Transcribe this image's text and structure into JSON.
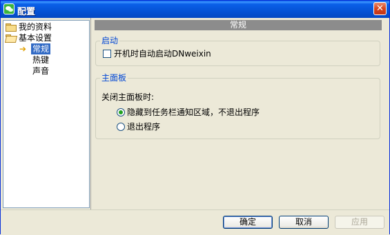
{
  "window": {
    "title": "配置"
  },
  "tree": {
    "items": [
      {
        "label": "我的资料",
        "icon": "folder-icon"
      },
      {
        "label": "基本设置",
        "icon": "folder-open-icon"
      },
      {
        "label": "常规",
        "icon": "arrow-right-icon",
        "selected": true
      },
      {
        "label": "热键"
      },
      {
        "label": "声音"
      }
    ]
  },
  "panel": {
    "header": "常规",
    "startup": {
      "title": "启动",
      "checkbox_label": "开机时自动启动DNweixin",
      "checked": false
    },
    "mainpanel": {
      "title": "主面板",
      "close_label": "关闭主面板时:",
      "options": [
        {
          "label": "隐藏到任务栏通知区域，不退出程序",
          "checked": true
        },
        {
          "label": "退出程序",
          "checked": false
        }
      ]
    }
  },
  "buttons": {
    "ok": "确定",
    "cancel": "取消",
    "apply": "应用"
  },
  "colors": {
    "titlebar": "#0553d6",
    "selection": "#316ac5",
    "group_label": "#0046d5",
    "header_bar": "#8c8c8c"
  }
}
